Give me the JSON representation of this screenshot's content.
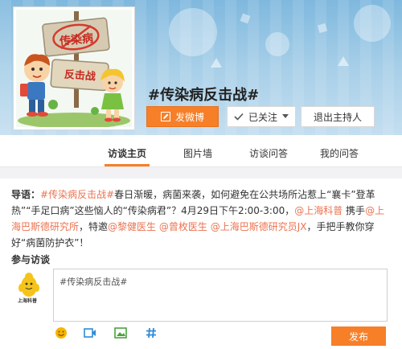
{
  "topic": {
    "logo_text_top": "传染病",
    "logo_text_bottom": "反击战",
    "title": "#传染病反击战#"
  },
  "actions": {
    "post_label": "发微博",
    "follow_label": "已关注",
    "exit_host_label": "退出主持人"
  },
  "tabs": [
    {
      "label": "访谈主页"
    },
    {
      "label": "图片墙"
    },
    {
      "label": "访谈问答"
    },
    {
      "label": "我的问答"
    }
  ],
  "intro": {
    "lead": "导语：",
    "hashtag": "#传染病反击战#",
    "text1": "春日渐暖，病菌来袭，如何避免在公共场所沾惹上“襄卡”登革热”“手足口病”这些恼人的“传染病君”？4月29日下午2:00-3:00，",
    "mention1": "@上海科普",
    "text2": " 携手",
    "mention2": "@上海巴斯德研究所",
    "text3": "，特邀",
    "mention3": "@黎健医生",
    "text4": " ",
    "mention4": "@曾枚医生",
    "text5": " ",
    "mention5": "@上海巴斯德研究员JX",
    "text6": "，手把手教你穿好“病菌防护衣”！"
  },
  "participate": {
    "title": "参与访谈",
    "avatar_caption": "上海科普",
    "compose_value": "#传染病反击战#",
    "publish_label": "发布"
  },
  "icons": {
    "edit": "edit-icon",
    "check": "check-icon",
    "dropdown": "chevron-down-icon",
    "emoji": "emoji-icon",
    "video": "video-icon",
    "image": "image-icon",
    "topic": "hashtag-icon"
  },
  "colors": {
    "accent": "#f77f28",
    "link": "#eb7350",
    "tool_icon": "#2e8bd6"
  }
}
